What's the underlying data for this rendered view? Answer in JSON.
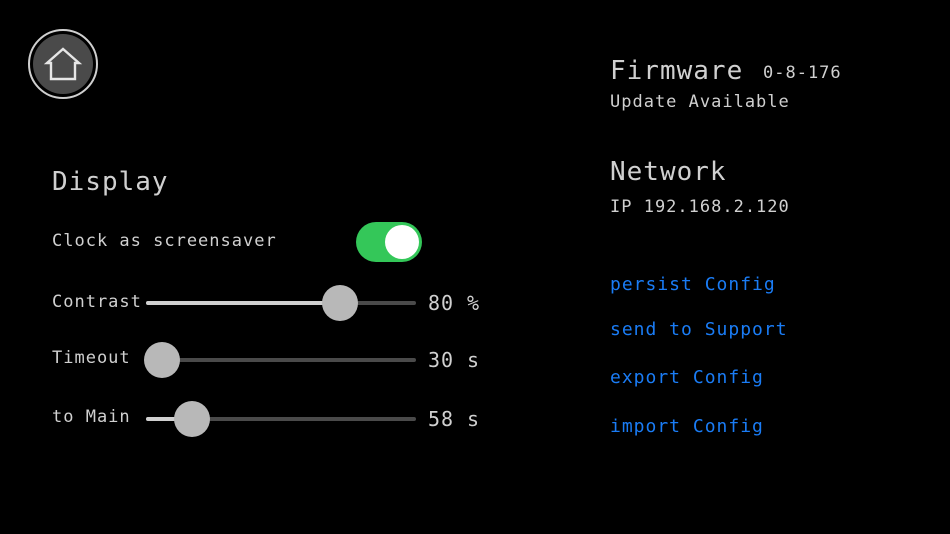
{
  "home": {
    "icon": "home-icon"
  },
  "display": {
    "title": "Display",
    "clock_label": "Clock as screensaver",
    "clock_enabled": true,
    "toggle_color": "#34c759",
    "sliders": [
      {
        "label": "Contrast",
        "value": "80",
        "unit": "%",
        "level": 0.72
      },
      {
        "label": "Timeout",
        "value": "30",
        "unit": "s",
        "level": 0.06
      },
      {
        "label": "to Main",
        "value": "58",
        "unit": "s",
        "level": 0.17
      }
    ]
  },
  "firmware": {
    "title": "Firmware",
    "version": "0-8-176",
    "status": "Update Available"
  },
  "network": {
    "title": "Network",
    "ip": "IP 192.168.2.120"
  },
  "actions": {
    "link_color": "#1a7cf5",
    "persist": "persist Config",
    "support": "send to Support",
    "export": "export Config",
    "import": "import Config"
  }
}
